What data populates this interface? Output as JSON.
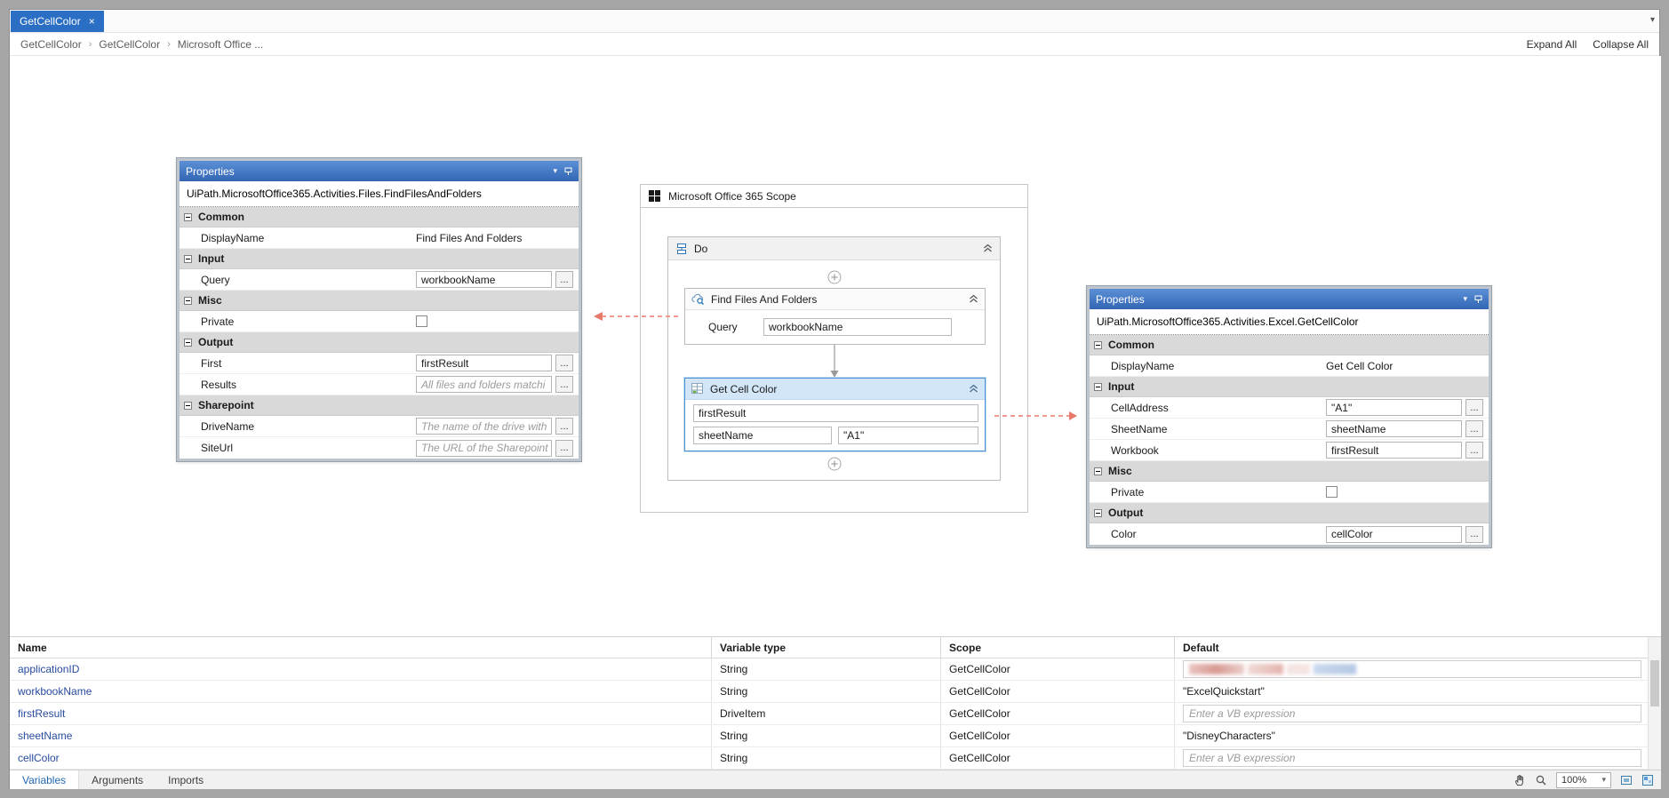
{
  "ui": {
    "browse": "...",
    "close_glyph": "×",
    "caret": "▾",
    "overflow_caret": "▾"
  },
  "tab_strip": {
    "active_tab": "GetCellColor"
  },
  "breadcrumb": {
    "crumbs": [
      "GetCellColor",
      "GetCellColor",
      "Microsoft Office ..."
    ],
    "separator": "›",
    "expand_all": "Expand All",
    "collapse_all": "Collapse All"
  },
  "left_properties": {
    "title": "Properties",
    "activity_type": "UiPath.MicrosoftOffice365.Activities.Files.FindFilesAndFolders",
    "sections": {
      "common": "Common",
      "input": "Input",
      "misc": "Misc",
      "output": "Output",
      "sharepoint": "Sharepoint"
    },
    "rows": {
      "display_name": {
        "label": "DisplayName",
        "value": "Find Files And Folders"
      },
      "query": {
        "label": "Query",
        "value": "workbookName"
      },
      "private": {
        "label": "Private"
      },
      "first": {
        "label": "First",
        "value": "firstResult"
      },
      "results": {
        "label": "Results",
        "placeholder": "All files and folders matchi"
      },
      "drive_name": {
        "label": "DriveName",
        "placeholder": "The name of the drive with"
      },
      "site_url": {
        "label": "SiteUrl",
        "placeholder": "The URL of the Sharepoint"
      }
    }
  },
  "right_properties": {
    "title": "Properties",
    "activity_type": "UiPath.MicrosoftOffice365.Activities.Excel.GetCellColor",
    "sections": {
      "common": "Common",
      "input": "Input",
      "misc": "Misc",
      "output": "Output"
    },
    "rows": {
      "display_name": {
        "label": "DisplayName",
        "value": "Get Cell Color"
      },
      "cell_address": {
        "label": "CellAddress",
        "value": "\"A1\""
      },
      "sheet_name": {
        "label": "SheetName",
        "value": "sheetName"
      },
      "workbook": {
        "label": "Workbook",
        "value": "firstResult"
      },
      "private": {
        "label": "Private"
      },
      "color": {
        "label": "Color",
        "value": "cellColor"
      }
    }
  },
  "workflow": {
    "scope_title": "Microsoft Office 365 Scope",
    "do_label": "Do",
    "find_activity": {
      "title": "Find Files And Folders",
      "query_label": "Query",
      "query_value": "workbookName"
    },
    "get_cell_activity": {
      "title": "Get Cell Color",
      "workbook_value": "firstResult",
      "sheet_value": "sheetName",
      "cell_value": "\"A1\""
    }
  },
  "variables_panel": {
    "columns": [
      "Name",
      "Variable type",
      "Scope",
      "Default"
    ],
    "rows": [
      {
        "name": "applicationID",
        "type": "String",
        "scope": "GetCellColor",
        "default": "",
        "redacted": true
      },
      {
        "name": "workbookName",
        "type": "String",
        "scope": "GetCellColor",
        "default": "\"ExcelQuickstart\""
      },
      {
        "name": "firstResult",
        "type": "DriveItem",
        "scope": "GetCellColor",
        "default": "Enter a VB expression",
        "placeholder": true
      },
      {
        "name": "sheetName",
        "type": "String",
        "scope": "GetCellColor",
        "default": "\"DisneyCharacters\""
      },
      {
        "name": "cellColor",
        "type": "String",
        "scope": "GetCellColor",
        "default": "Enter a VB expression",
        "placeholder": true
      }
    ]
  },
  "bottom_bar": {
    "tabs": [
      "Variables",
      "Arguments",
      "Imports"
    ],
    "zoom_level": "100%"
  },
  "colors": {
    "accent_blue": "#2b6fc4",
    "selection_blue": "#d2e6f8",
    "arrow_red": "#e8796a"
  }
}
